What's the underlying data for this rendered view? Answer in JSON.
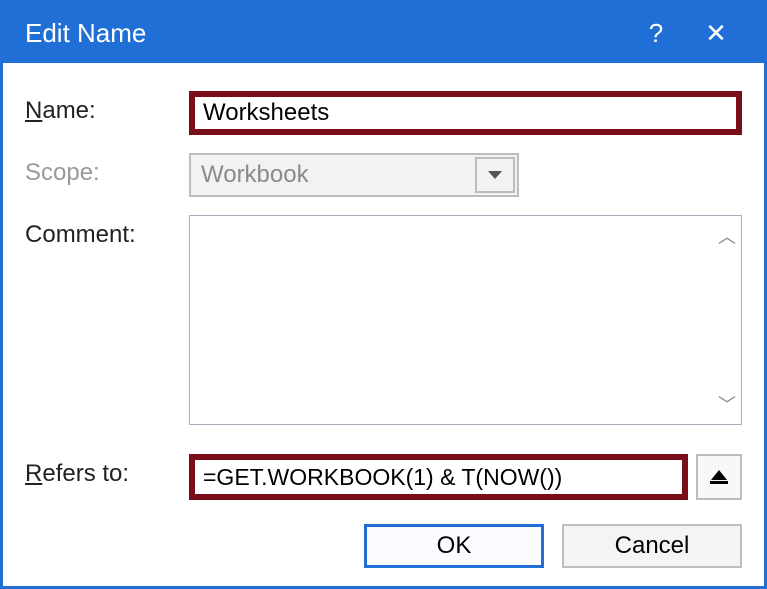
{
  "titlebar": {
    "title": "Edit Name",
    "help": "?",
    "close": "✕"
  },
  "labels": {
    "name_prefix": "N",
    "name_rest": "ame:",
    "scope_prefix": "S",
    "scope_rest": "cope:",
    "comment_prefix": "C",
    "comment_rest": "omment:",
    "refers_prefix": "R",
    "refers_rest": "efers to:"
  },
  "fields": {
    "name_value": "Worksheets",
    "scope_value": "Workbook",
    "comment_value": "",
    "refers_value": "=GET.WORKBOOK(1) & T(NOW())"
  },
  "buttons": {
    "ok": "OK",
    "cancel": "Cancel"
  }
}
